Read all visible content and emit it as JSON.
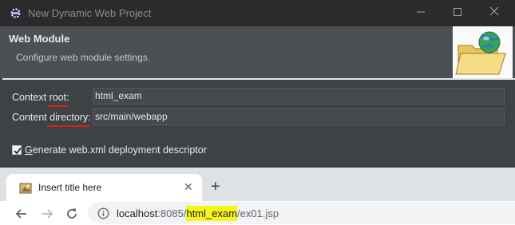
{
  "window": {
    "title": "New Dynamic Web Project",
    "minimize_icon": "minimize-icon",
    "maximize_icon": "maximize-icon",
    "close_icon": "close-icon"
  },
  "banner": {
    "title": "Web Module",
    "description": "Configure web module settings."
  },
  "form": {
    "context_root": {
      "label_pre": "Context ",
      "label_ul": "root",
      "label_post": ":",
      "value": "html_exam"
    },
    "content_directory": {
      "label_pre": "Content ",
      "label_ul": "directory",
      "label_post": ":",
      "value": "src/main/webapp"
    },
    "generate_web_xml": {
      "label_first": "G",
      "label_rest": "enerate web.xml deployment descriptor",
      "checked": true
    }
  },
  "annotation_color": "#d42020",
  "browser": {
    "tab": {
      "title": "Insert title here",
      "close_glyph": "✕"
    },
    "new_tab_glyph": "+",
    "url": {
      "host": "localhost",
      "port_sep": ":8085/",
      "project": "html_exam",
      "path": "/ex01.jsp"
    },
    "highlight_color": "#f6f61a"
  }
}
